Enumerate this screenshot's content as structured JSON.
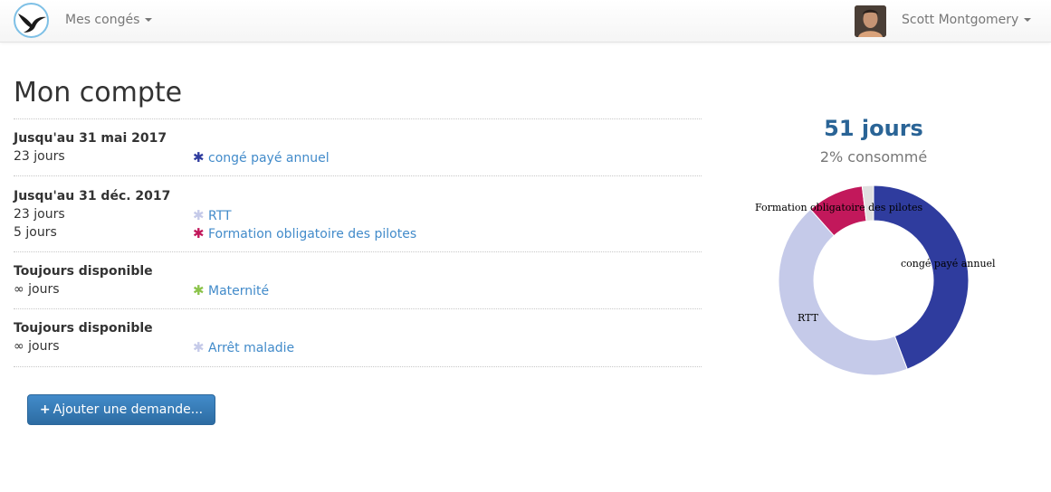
{
  "navbar": {
    "menu_label": "Mes congés",
    "user_name": "Scott Montgomery"
  },
  "main": {
    "title": "Mon compte",
    "blocks": [
      {
        "title": "Jusqu'au 31 mai 2017",
        "rows": [
          {
            "days": "23 jours",
            "label": "congé payé annuel",
            "color": "#2f3c9e"
          }
        ]
      },
      {
        "title": "Jusqu'au 31 déc. 2017",
        "rows": [
          {
            "days": "23 jours",
            "label": "RTT",
            "color": "#c5cae9"
          },
          {
            "days": "5 jours",
            "label": "Formation obligatoire des pilotes",
            "color": "#c2185b"
          }
        ]
      },
      {
        "title": "Toujours disponible",
        "rows": [
          {
            "days": "∞ jours",
            "label": "Maternité",
            "color": "#8bc34a"
          }
        ]
      },
      {
        "title": "Toujours disponible",
        "rows": [
          {
            "days": "∞ jours",
            "label": "Arrêt maladie",
            "color": "#c5cae9"
          }
        ]
      }
    ],
    "star_glyph": "✱",
    "add_button_label": "Ajouter une demande...",
    "add_button_icon": "+"
  },
  "summary": {
    "total": "51 jours",
    "consumed": "2% consommé"
  },
  "chart_data": {
    "type": "pie",
    "donut": true,
    "slices": [
      {
        "label": "congé payé annuel",
        "value": 23,
        "color": "#2f3c9e"
      },
      {
        "label": "RTT",
        "value": 23,
        "color": "#c5cae9"
      },
      {
        "label": "Formation obligatoire des pilotes",
        "value": 5,
        "color": "#c2185b"
      },
      {
        "label": "",
        "value": 1,
        "color": "#e0e0e0"
      }
    ]
  }
}
